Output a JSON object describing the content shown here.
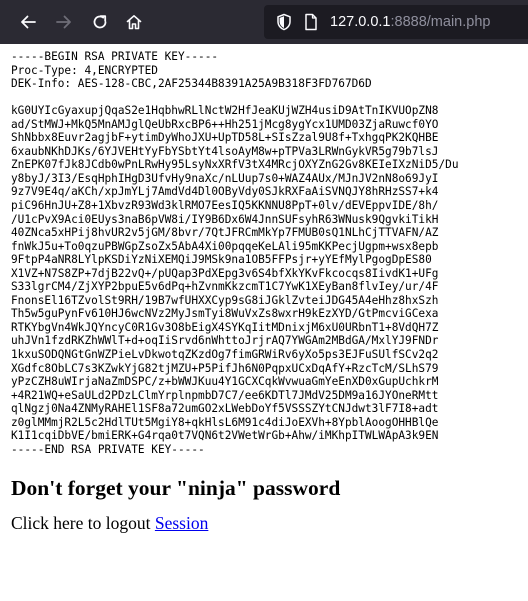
{
  "browser": {
    "url_host": "127.0.0.1",
    "url_rest": ":8888/main.php",
    "icons": {
      "back": "arrow-left-icon",
      "forward": "arrow-right-icon",
      "reload": "reload-icon",
      "home": "home-icon",
      "shield": "shield-icon",
      "page": "page-info-icon"
    },
    "colors": {
      "toolbar": "#2b2a33",
      "urlbar": "#1c1b22",
      "link": "#0000ee"
    }
  },
  "page": {
    "key_header": [
      "-----BEGIN RSA PRIVATE KEY-----",
      "Proc-Type: 4,ENCRYPTED",
      "DEK-Info: AES-128-CBC,2AF25344B8391A25A9B318F3FD767D6D",
      ""
    ],
    "key_body": [
      "kG0UYIcGyaxupjQqaS2e1HqbhwRLlNctW2HfJeaKUjWZH4usiD9AtTnIKVUOpZN8",
      "ad/StMWJ+MkQ5MnAMJglQeUbRxcBP6++Hh251jMcg8ygYcx1UMD03ZjaRuwcf0YO",
      "ShNbbx8Euvr2agjbF+ytimDyWhoJXU+UpTD58L+SIsZzal9U8f+TxhgqPK2KQHBE",
      "6xaubNKhDJKs/6YJVEHtYyFbYSbtYt4lsoAyM8w+pTPVa3LRWnGykVR5g79b7lsJ",
      "ZnEPK07fJk8JCdb0wPnLRwHy95LsyNxXRfV3tX4MRcjOXYZnG2Gv8KEIeIXzNiD5/Du",
      "y8byJ/3I3/EsqHphIHgD3UfvHy9naXc/nLUup7s0+WAZ4AUx/MJnJV2nN8o69JyI",
      "9z7V9E4q/aKCh/xpJmYLj7AmdVd4Dl0OByVdy0SJkRXFaAiSVNQJY8hRHzSS7+k4",
      "piC96HnJU+Z8+1XbvzR93Wd3klRMO7EesIQ5KKNNU8PpT+0lv/dEVEppvIDE/8h/",
      "/U1cPvX9Aci0EUys3naB6pVW8i/IY9B6Dx6W4JnnSUFsyhR63WNusk9QgvkiTikH",
      "40ZNca5xHPij8hvUR2v5jGM/8bvr/7QtJFRCmMkYp7FMUB0sQ1NLhCjTTVAFN/AZ",
      "fnWkJ5u+To0qzuPBWGpZsoZx5AbA4Xi00pqqeKeLAli95mKKPecjUgpm+wsx8epb",
      "9FtpP4aNR8LYlpKSDiYzNiXEMQiJ9MSk9na1OB5FFPsjr+yYEfMylPgogDpES80",
      "X1VZ+N7S8ZP+7djB22vQ+/pUQap3PdXEpg3v6S4bfXkYKvFkcocqs8IivdK1+UFg",
      "S33lgrCM4/ZjXYP2bpuE5v6dPq+hZvnmKkzcmT1C7YwK1XEyBan8flvIey/ur/4F",
      "FnonsEl16TZvolSt9RH/19B7wfUHXXCyp9sG8iJGklZvteiJDG45A4eHhz8hxSzh",
      "Th5w5guPynFv610HJ6wcNVz2MyJsmTyi8WuVxZs8wxrH9kEzXYD/GtPmcviGCexa",
      "RTKYbgVn4WkJQYncyC0R1Gv3O8bEigX4SYKqIitMDnixjM6xU0URbnT1+8VdQH7Z",
      "uhJVn1fzdRKZhWWlT+d+oqIiSrvd6nWhttoJrjrAQ7YWGAm2MBdGA/MxlYJ9FNDr",
      "1kxuSODQNGtGnWZPieLvDkwotqZKzdOg7fimGRWiRv6yXo5ps3EJFuSUlfSCv2q2",
      "XGdfc8ObLC7s3KZwkYjG82tjMZU+P5PifJh6N0PqpxUCxDqAfY+RzcTcM/SLhS79",
      "yPzCZH8uWIrjaNaZmDSPC/z+bWWJKuu4Y1GCXCqkWvwuaGmYeEnXD0xGupUchkrM",
      "+4R21WQ+eSaULd2PDzLClmYrplnpmbD7C7/ee6KDTl7JMdV25DM9a16JYOneRMtt",
      "qlNgzj0Na4ZNMyRAHEl1SF8a72umGO2xLWebDoYf5VSSSZYtCNJdwt3lF7I8+adt",
      "z0glMMmjR2L5c2HdlTUt5MgiY8+qkHlsL6M91c4diJoEXVh+8YpblAoogOHHBlQe",
      "K1I1cqiDbVE/bmiERK+G4rqa0t7VQN6t2VWetWrGb+Ahw/iMKhpITWLWApA3k9EN"
    ],
    "key_footer": "-----END RSA PRIVATE KEY-----",
    "heading": "Don't forget your \"ninja\" password",
    "logout_prefix": "Click here to logout ",
    "logout_link": "Session"
  }
}
